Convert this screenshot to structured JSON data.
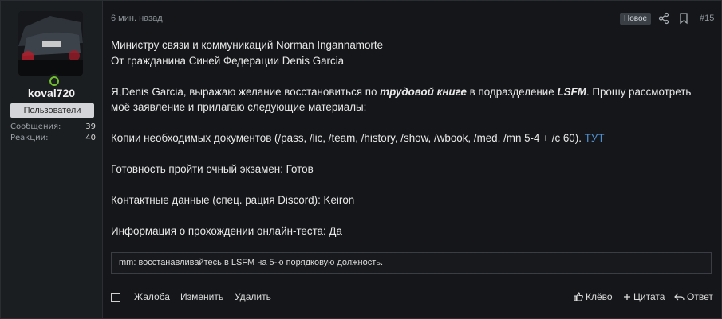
{
  "user": {
    "name": "koval720",
    "role": "Пользователи",
    "stats": [
      {
        "label": "Сообщения:",
        "value": "39"
      },
      {
        "label": "Реакции:",
        "value": "40"
      }
    ]
  },
  "post": {
    "date": "6 мин. назад",
    "badge": "Новое",
    "number": "#15",
    "lines": {
      "l1": "Министру связи и коммуникаций Norman Ingannamorte",
      "l2": "От гражданина Синей Федерации Denis Garcia",
      "p1_a": "Я,Denis Garcia, выражаю желание восстановиться по ",
      "p1_em1": "трудовой книге",
      "p1_b": " в подразделение ",
      "p1_em2": "LSFM",
      "p1_c": ". Прошу рассмотреть моё заявление и прилагаю следующие материалы:",
      "docs": "Копии необходимых документов (/pass, /lic, /team, /history, /show, /wbook, /med, /mn 5-4 + /c 60). ",
      "docs_link": "ТУТ",
      "exam": "Готовность пройти очный экзамен: Готов",
      "contact": "Контактные данные (спец. рация Discord): Keiron",
      "test": "Информация о прохождении онлайн-теста: Да"
    },
    "quote": "mm: восстанавливайтесь в LSFM на 5-ю порядковую должность."
  },
  "footer": {
    "report": "Жалоба",
    "edit": "Изменить",
    "delete": "Удалить",
    "like": "Клёво",
    "quote": "Цитата",
    "reply": "Ответ"
  },
  "icons": {
    "share": "share-icon",
    "bookmark": "bookmark-icon",
    "like": "thumbs-up-icon",
    "quote": "plus-icon",
    "reply": "reply-icon"
  },
  "colors": {
    "background": "#141619",
    "sidebar": "#1b1e21",
    "link": "#4f8ed0",
    "online": "#6fbf2c",
    "role_badge": "#d3d5d8"
  }
}
